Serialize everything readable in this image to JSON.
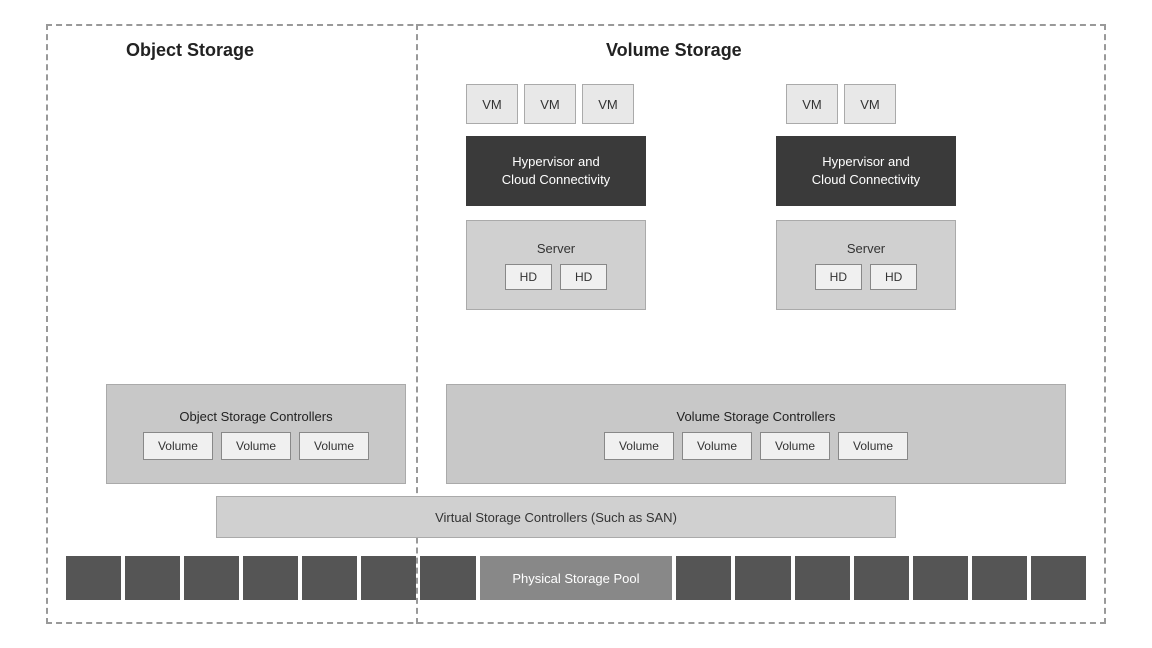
{
  "diagram": {
    "title_object": "Object Storage",
    "title_volume": "Volume Storage",
    "obj_controllers_label": "Object Storage Controllers",
    "vol_controllers_label": "Volume Storage Controllers",
    "virtual_controllers_label": "Virtual Storage Controllers (Such as SAN)",
    "physical_pool_label": "Physical Storage Pool",
    "vm_label": "VM",
    "server_label": "Server",
    "hd_label": "HD",
    "volume_label": "Volume",
    "hypervisor_label": "Hypervisor and\nCloud Connectivity"
  }
}
